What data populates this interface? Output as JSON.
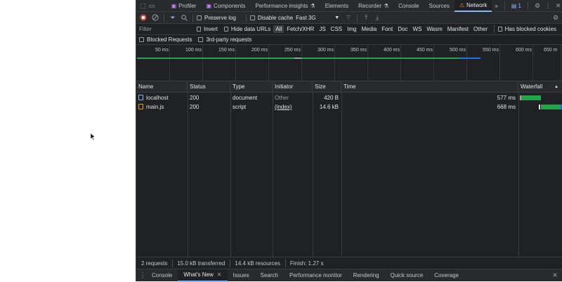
{
  "tabs": {
    "items": [
      {
        "label": "Profiler",
        "icon": "react-icon"
      },
      {
        "label": "Components",
        "icon": "react-icon"
      },
      {
        "label": "Performance insights",
        "icon": "flask-icon"
      },
      {
        "label": "Elements",
        "icon": ""
      },
      {
        "label": "Recorder",
        "icon": "flask-icon"
      },
      {
        "label": "Console",
        "icon": ""
      },
      {
        "label": "Sources",
        "icon": ""
      },
      {
        "label": "Network",
        "icon": "warning-icon"
      }
    ],
    "active": "Network",
    "more": "»",
    "issues_count": "1"
  },
  "toolbar": {
    "preserve_log": "Preserve log",
    "disable_cache": "Disable cache",
    "throttling": "Fast 3G"
  },
  "filterbar": {
    "placeholder": "Filter",
    "invert": "Invert",
    "hide_data_urls": "Hide data URLs",
    "types": [
      "All",
      "Fetch/XHR",
      "JS",
      "CSS",
      "Img",
      "Media",
      "Font",
      "Doc",
      "WS",
      "Wasm",
      "Manifest",
      "Other"
    ],
    "active_type": "All",
    "has_blocked_cookies": "Has blocked cookies"
  },
  "filterbar2": {
    "blocked_requests": "Blocked Requests",
    "third_party": "3rd-party requests"
  },
  "overview": {
    "ticks": [
      "50 ms",
      "100 ms",
      "150 ms",
      "200 ms",
      "250 ms",
      "300 ms",
      "350 ms",
      "400 ms",
      "450 ms",
      "500 ms",
      "550 ms",
      "600 ms",
      "650 m"
    ]
  },
  "table": {
    "headers": [
      "Name",
      "Status",
      "Type",
      "Initiator",
      "Size",
      "Time",
      "Waterfall"
    ],
    "rows": [
      {
        "name": "localhost",
        "status": "200",
        "type": "document",
        "initiator": "Other",
        "size": "420 B",
        "time": "577 ms"
      },
      {
        "name": "main.js",
        "status": "200",
        "type": "script",
        "initiator": "(index)",
        "size": "14.6 kB",
        "time": "668 ms"
      }
    ]
  },
  "status": {
    "requests": "2 requests",
    "transferred": "15.0 kB transferred",
    "resources": "14.4 kB resources",
    "finish": "Finish: 1.27 s"
  },
  "drawer": {
    "tabs": [
      "Console",
      "What's New",
      "Issues",
      "Search",
      "Performance monitor",
      "Rendering",
      "Quick source",
      "Coverage"
    ],
    "active": "What's New"
  },
  "colors": {
    "accent": "#8ab4f8",
    "waiting_green": "#21a649",
    "download_blue": "#1a73e8",
    "record_red": "#e8453c"
  }
}
